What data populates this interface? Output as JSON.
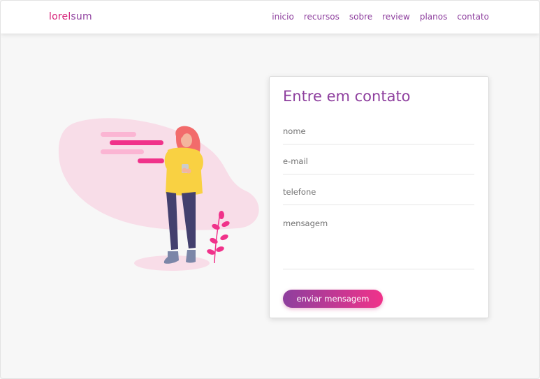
{
  "header": {
    "logo_part1": "lorel",
    "logo_part2": "sum",
    "nav": [
      "inicio",
      "recursos",
      "sobre",
      "review",
      "planos",
      "contato"
    ]
  },
  "contact": {
    "title": "Entre em contato",
    "fields": {
      "name_placeholder": "nome",
      "email_placeholder": "e-mail",
      "phone_placeholder": "telefone",
      "message_placeholder": "mensagem"
    },
    "submit_label": "enviar mensagem"
  },
  "colors": {
    "brand_purple": "#8e3f9e",
    "brand_pink": "#d6247a",
    "accent_pink": "#f0328a",
    "background": "#f7f7f7"
  }
}
